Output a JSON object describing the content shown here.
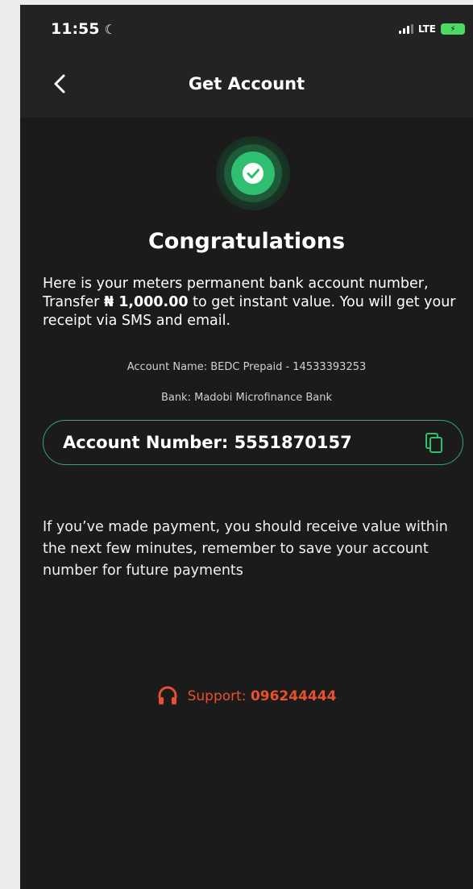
{
  "status": {
    "time": "11:55",
    "moon_icon": "moon-icon",
    "network": "LTE"
  },
  "header": {
    "back_icon": "chevron-left-icon",
    "title": "Get Account"
  },
  "success_icon": "check-circle-icon",
  "content": {
    "title": "Congratulations",
    "intro_before": "Here is your meters permanent bank account number, Transfer ",
    "intro_amount": "₦ 1,000.00",
    "intro_after": " to get instant value. You will get your receipt via SMS and email.",
    "account_name": "Account Name: BEDC Prepaid - 14533393253",
    "bank": "Bank: Madobi Microfinance Bank",
    "account_number": "Account Number: 5551870157",
    "note": "If you’ve made payment, you should receive value within the next few minutes, remember to save your account number for future payments"
  },
  "support": {
    "label": "Support: ",
    "number": "096244444",
    "icon": "headset-icon"
  },
  "colors": {
    "background": "#1b1b1b",
    "header": "#232323",
    "accent_green": "#2fbf71",
    "support_orange": "#e8502e"
  }
}
